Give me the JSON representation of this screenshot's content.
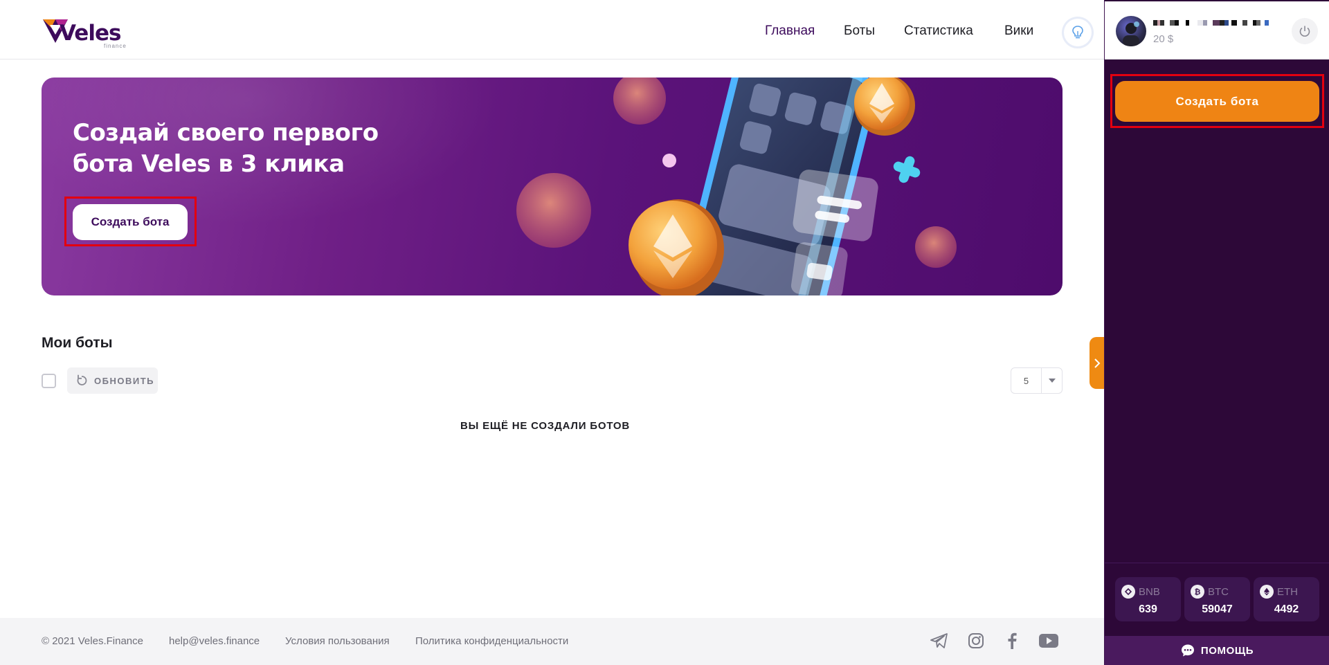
{
  "brand": {
    "name": "Veles",
    "sub": "finance"
  },
  "nav": {
    "items": [
      {
        "label": "Главная",
        "active": true
      },
      {
        "label": "Боты",
        "active": false
      },
      {
        "label": "Статистика",
        "active": false
      },
      {
        "label": "Вики",
        "active": false
      }
    ],
    "tips_icon": "lightbulb-icon"
  },
  "banner": {
    "title_line1": "Создай своего первого",
    "title_line2": "бота Veles в 3 клика",
    "button_label": "Создать бота"
  },
  "bots": {
    "title": "Мои боты",
    "refresh_label": "ОБНОВИТЬ",
    "per_page": "5",
    "empty_text": "ВЫ ЕЩЁ НЕ СОЗДАЛИ БОТОВ"
  },
  "footer": {
    "copyright": "© 2021 Veles.Finance",
    "email": "help@veles.finance",
    "terms": "Условия пользования",
    "privacy": "Политика конфиденциальности",
    "socials": [
      "telegram-icon",
      "instagram-icon",
      "facebook-icon",
      "youtube-icon"
    ]
  },
  "user": {
    "balance": "20 $"
  },
  "sidebar": {
    "create_label": "Создать бота",
    "coins": [
      {
        "symbol": "BNB",
        "price": "639",
        "icon": "bnb-icon"
      },
      {
        "symbol": "BTC",
        "price": "59047",
        "icon": "btc-icon"
      },
      {
        "symbol": "ETH",
        "price": "4492",
        "icon": "eth-icon"
      }
    ],
    "help_label": "ПОМОЩЬ"
  },
  "colors": {
    "brand_purple": "#3d0b5c",
    "accent_orange": "#ef8414",
    "sidebar_bg": "#2d0838",
    "highlight_red": "#e3000f"
  }
}
